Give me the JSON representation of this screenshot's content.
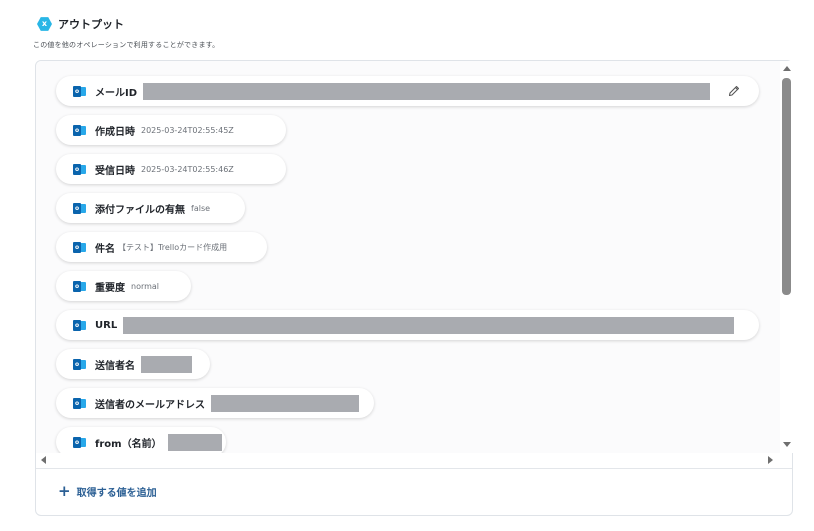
{
  "header": {
    "icon": "x-hexagon-icon",
    "icon_glyph": "x",
    "title": "アウトプット"
  },
  "subtitle": "この値を他のオペレーションで利用することができます。",
  "outlook_glyph": "o",
  "items": [
    {
      "label": "メールID",
      "value": "",
      "redacted": true,
      "editable": true
    },
    {
      "label": "作成日時",
      "value": "2025-03-24T02:55:45Z"
    },
    {
      "label": "受信日時",
      "value": "2025-03-24T02:55:46Z"
    },
    {
      "label": "添付ファイルの有無",
      "value": "false"
    },
    {
      "label": "件名",
      "value": "【テスト】Trelloカード作成用"
    },
    {
      "label": "重要度",
      "value": "normal"
    },
    {
      "label": "URL",
      "value": "",
      "redacted": true
    },
    {
      "label": "送信者名",
      "value": "",
      "redacted": true
    },
    {
      "label": "送信者のメールアドレス",
      "value": "",
      "redacted": true
    },
    {
      "label": "from（名前）",
      "value": "",
      "redacted": true
    }
  ],
  "add_button": {
    "icon": "plus-icon",
    "label": "取得する値を追加"
  },
  "colors": {
    "accent": "#29b6e6",
    "outlook_dark": "#0a64ad",
    "outlook_light": "#28a8ea",
    "link": "#2b5f94",
    "redaction": "#a9abb0"
  }
}
